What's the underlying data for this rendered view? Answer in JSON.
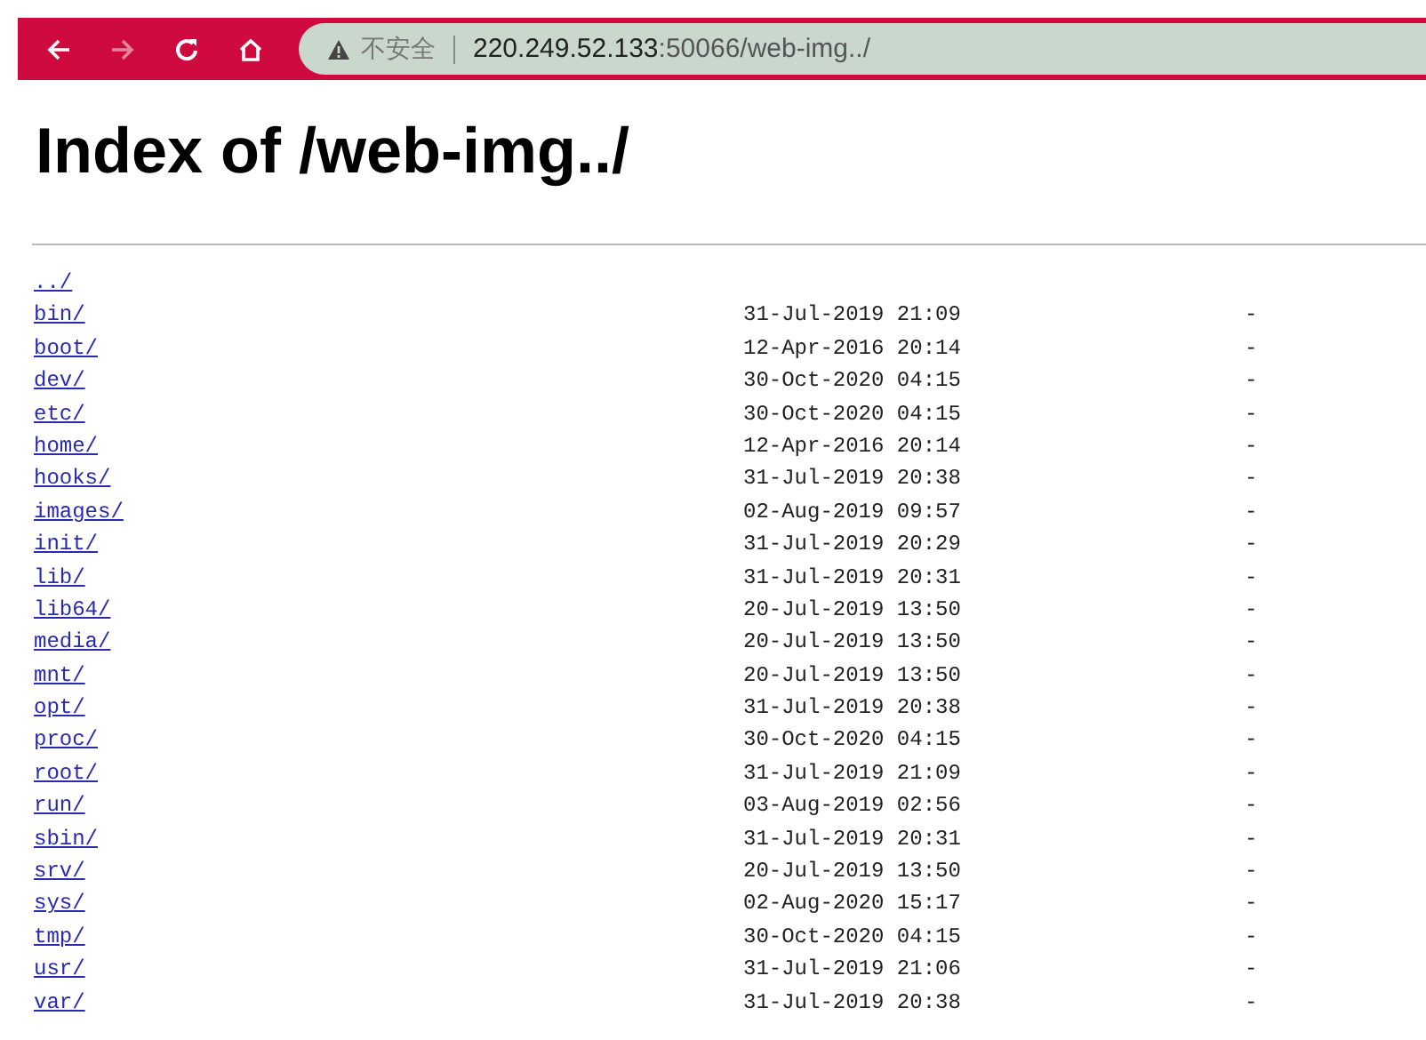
{
  "toolbar": {
    "buttons": [
      {
        "kind": "back",
        "disabled": false
      },
      {
        "kind": "forward",
        "disabled": true
      },
      {
        "kind": "reload",
        "disabled": false
      },
      {
        "kind": "home",
        "disabled": false
      }
    ],
    "security_label": "不安全",
    "url_host": "220.249.52.133",
    "url_rest": ":50066/web-img../"
  },
  "heading": "Index of /web-img../",
  "entries": [
    {
      "name": "../"
    },
    {
      "name": "bin/",
      "date": "31-Jul-2019 21:09",
      "size": "-"
    },
    {
      "name": "boot/",
      "date": "12-Apr-2016 20:14",
      "size": "-"
    },
    {
      "name": "dev/",
      "date": "30-Oct-2020 04:15",
      "size": "-"
    },
    {
      "name": "etc/",
      "date": "30-Oct-2020 04:15",
      "size": "-"
    },
    {
      "name": "home/",
      "date": "12-Apr-2016 20:14",
      "size": "-"
    },
    {
      "name": "hooks/",
      "date": "31-Jul-2019 20:38",
      "size": "-"
    },
    {
      "name": "images/",
      "date": "02-Aug-2019 09:57",
      "size": "-"
    },
    {
      "name": "init/",
      "date": "31-Jul-2019 20:29",
      "size": "-"
    },
    {
      "name": "lib/",
      "date": "31-Jul-2019 20:31",
      "size": "-"
    },
    {
      "name": "lib64/",
      "date": "20-Jul-2019 13:50",
      "size": "-"
    },
    {
      "name": "media/",
      "date": "20-Jul-2019 13:50",
      "size": "-"
    },
    {
      "name": "mnt/",
      "date": "20-Jul-2019 13:50",
      "size": "-"
    },
    {
      "name": "opt/",
      "date": "31-Jul-2019 20:38",
      "size": "-"
    },
    {
      "name": "proc/",
      "date": "30-Oct-2020 04:15",
      "size": "-"
    },
    {
      "name": "root/",
      "date": "31-Jul-2019 21:09",
      "size": "-"
    },
    {
      "name": "run/",
      "date": "03-Aug-2019 02:56",
      "size": "-"
    },
    {
      "name": "sbin/",
      "date": "31-Jul-2019 20:31",
      "size": "-"
    },
    {
      "name": "srv/",
      "date": "20-Jul-2019 13:50",
      "size": "-"
    },
    {
      "name": "sys/",
      "date": "02-Aug-2020 15:17",
      "size": "-"
    },
    {
      "name": "tmp/",
      "date": "30-Oct-2020 04:15",
      "size": "-"
    },
    {
      "name": "usr/",
      "date": "31-Jul-2019 21:06",
      "size": "-"
    },
    {
      "name": "var/",
      "date": "31-Jul-2019 20:38",
      "size": "-"
    }
  ]
}
